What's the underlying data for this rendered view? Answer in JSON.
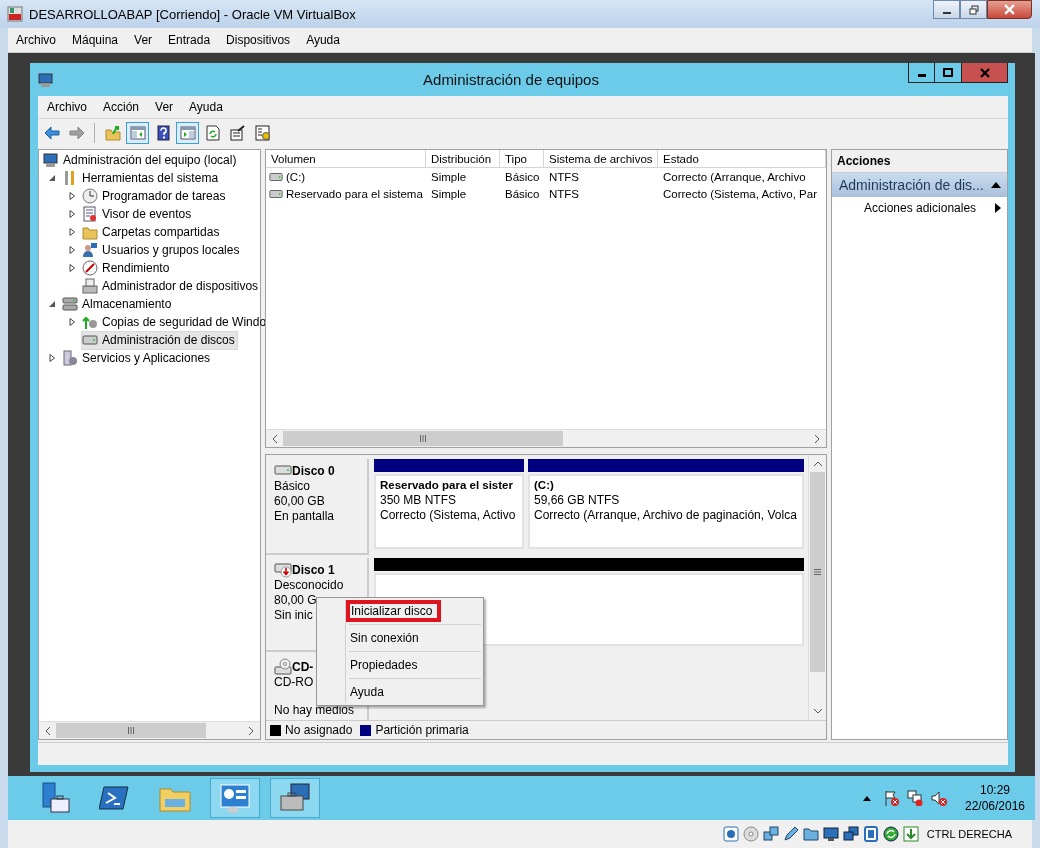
{
  "vbox": {
    "title": "DESARROLLOABAP [Corriendo] - Oracle VM VirtualBox",
    "menu": [
      "Archivo",
      "Máquina",
      "Ver",
      "Entrada",
      "Dispositivos",
      "Ayuda"
    ],
    "status_text": "CTRL DERECHA"
  },
  "window": {
    "title": "Administración de equipos",
    "menu": [
      "Archivo",
      "Acción",
      "Ver",
      "Ayuda"
    ]
  },
  "toolbar": [
    {
      "kind": "back",
      "disabled": false
    },
    {
      "kind": "forward",
      "disabled": true
    },
    {
      "kind": "separator"
    },
    {
      "kind": "up",
      "disabled": false
    },
    {
      "kind": "tree_toggle",
      "pressed": true
    },
    {
      "kind": "help",
      "disabled": false
    },
    {
      "kind": "actions_toggle",
      "pressed": true
    },
    {
      "kind": "refresh",
      "disabled": false
    },
    {
      "kind": "export",
      "disabled": false
    },
    {
      "kind": "properties",
      "disabled": false
    }
  ],
  "tree": [
    {
      "label": "Administración del equipo (local)",
      "selected": false,
      "children": [
        {
          "label": "Herramientas del sistema",
          "expanded": true,
          "selected": false,
          "children": [
            {
              "label": "Programador de tareas",
              "expanded": false,
              "selected": false
            },
            {
              "label": "Visor de eventos",
              "expanded": false,
              "selected": false
            },
            {
              "label": "Carpetas compartidas",
              "expanded": false,
              "selected": false
            },
            {
              "label": "Usuarios y grupos locales",
              "expanded": false,
              "selected": false
            },
            {
              "label": "Rendimiento",
              "expanded": false,
              "selected": false
            },
            {
              "label": "Administrador de dispositivos",
              "selected": false
            }
          ]
        },
        {
          "label": "Almacenamiento",
          "expanded": true,
          "selected": false,
          "children": [
            {
              "label": "Copias de seguridad de Windo",
              "expanded": false,
              "selected": false
            },
            {
              "label": "Administración de discos",
              "selected": true
            }
          ]
        },
        {
          "label": "Servicios y Aplicaciones",
          "expanded": false,
          "selected": false
        }
      ]
    }
  ],
  "volumes": {
    "columns": [
      "Volumen",
      "Distribución",
      "Tipo",
      "Sistema de archivos",
      "Estado"
    ],
    "rows": [
      [
        "(C:)",
        "Simple",
        "Básico",
        "NTFS",
        "Correcto (Arranque, Archivo"
      ],
      [
        "Reservado para el sistema",
        "Simple",
        "Básico",
        "NTFS",
        "Correcto (Sistema, Activo, Par"
      ]
    ]
  },
  "disks": [
    {
      "name": "Disco 0",
      "kind": "basic",
      "lines": [
        "Básico",
        "60,00 GB",
        "En pantalla"
      ],
      "partitions": [
        {
          "kind": "primary",
          "title": "Reservado para el sister",
          "size": "350 MB NTFS",
          "status": "Correcto (Sistema, Activo"
        },
        {
          "kind": "primary",
          "title": "(C:)",
          "size": "59,66 GB NTFS",
          "status": "Correcto (Arranque, Archivo de paginación, Volca"
        }
      ]
    },
    {
      "name": "Disco 1",
      "kind": "offline",
      "lines": [
        "Desconocido",
        "80,00 G",
        "Sin inic"
      ],
      "partitions": [
        {
          "kind": "unallocated"
        }
      ]
    },
    {
      "name": "CD-",
      "kind": "cdrom",
      "lines": [
        "CD-RO"
      ],
      "footer": "No hay medios"
    }
  ],
  "legend": [
    {
      "label": "No asignado",
      "color": "#000000"
    },
    {
      "label": "Partición primaria",
      "color": "#000080"
    }
  ],
  "context_menu": [
    {
      "label": "Inicializar disco",
      "highlighted": true
    },
    {
      "label": "Sin conexión",
      "highlighted": false
    },
    {
      "label": "Propiedades",
      "highlighted": false
    },
    {
      "label": "Ayuda",
      "highlighted": false
    }
  ],
  "actions": {
    "title": "Acciones",
    "section": "Administración de dis...",
    "items": [
      "Acciones adicionales"
    ]
  },
  "taskbar": {
    "apps": [
      {
        "kind": "server_manager",
        "running": false
      },
      {
        "kind": "powershell",
        "running": false
      },
      {
        "kind": "explorer",
        "running": false
      },
      {
        "kind": "control",
        "running": true
      },
      {
        "kind": "computer_management",
        "running": true
      }
    ],
    "time": "10:29",
    "date": "22/06/2016"
  }
}
